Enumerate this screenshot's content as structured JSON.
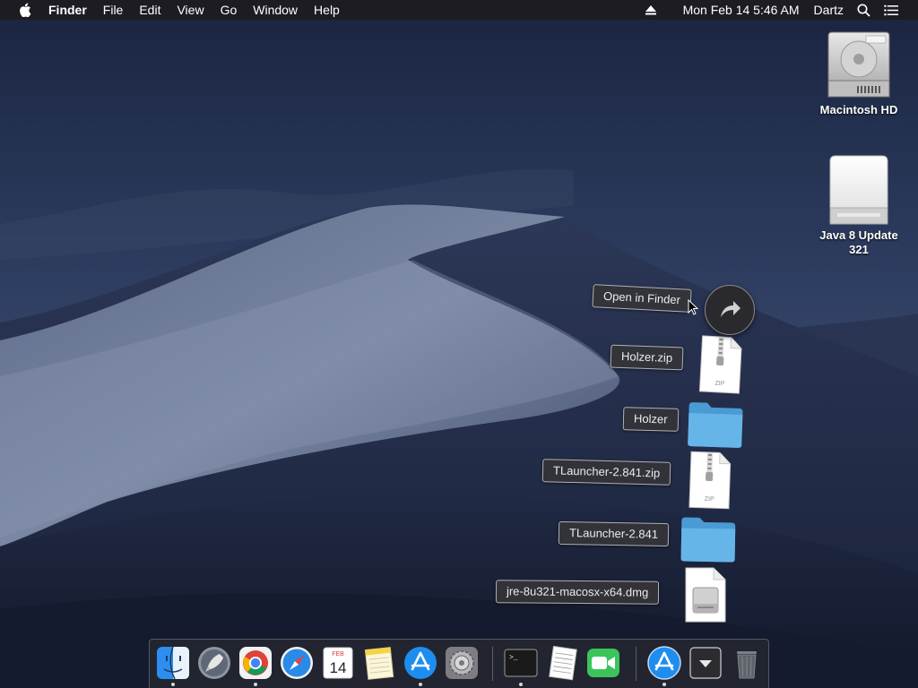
{
  "menubar": {
    "app_name": "Finder",
    "menus": [
      "File",
      "Edit",
      "View",
      "Go",
      "Window",
      "Help"
    ],
    "datetime": "Mon Feb 14  5:46 AM",
    "user": "Dartz"
  },
  "desktop": {
    "icons": [
      {
        "label": "Macintosh HD",
        "icon": "hard-drive-icon"
      },
      {
        "label": "Java 8 Update 321",
        "icon": "mounted-disk-image-icon"
      }
    ]
  },
  "stack": {
    "open_in_finder_label": "Open in Finder",
    "items": [
      {
        "label": "Holzer.zip",
        "icon": "zip-file-icon",
        "icon_text": "ZIP"
      },
      {
        "label": "Holzer",
        "icon": "folder-icon"
      },
      {
        "label": "TLauncher-2.841.zip",
        "icon": "zip-file-icon",
        "icon_text": "ZIP"
      },
      {
        "label": "TLauncher-2.841",
        "icon": "folder-icon"
      },
      {
        "label": "jre-8u321-macosx-x64.dmg",
        "icon": "dmg-file-icon"
      }
    ]
  },
  "dock": {
    "calendar_month": "FEB",
    "calendar_day": "14",
    "apps": [
      "finder-icon",
      "launchpad-icon",
      "chrome-icon",
      "safari-icon",
      "calendar-icon",
      "notes-icon",
      "app-store-icon",
      "system-preferences-icon",
      "terminal-icon",
      "textedit-icon",
      "facetime-icon",
      "downloads-stack-icon",
      "downloads-folder-icon",
      "trash-icon"
    ]
  },
  "colors": {
    "menubar_bg": "#1c1c20",
    "folder_blue": "#5aaee0",
    "label_bg": "#343438"
  }
}
